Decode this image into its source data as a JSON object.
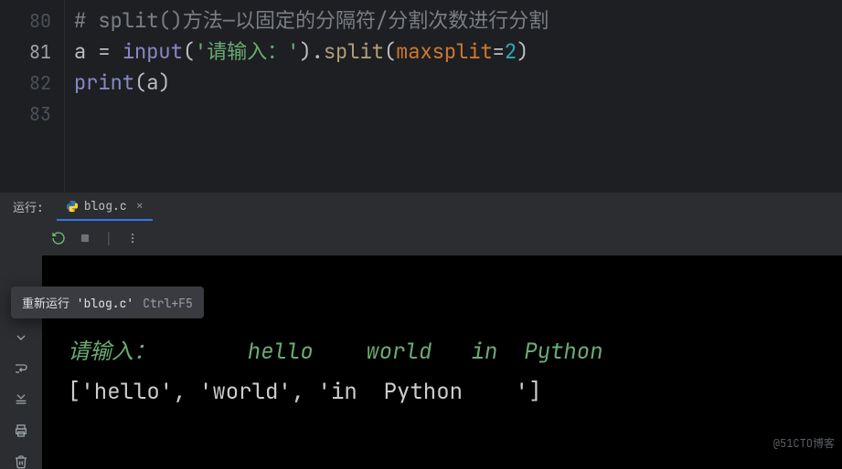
{
  "editor": {
    "lines": [
      {
        "num": "80",
        "active": false
      },
      {
        "num": "81",
        "active": true
      },
      {
        "num": "82",
        "active": false
      },
      {
        "num": "83",
        "active": false
      }
    ],
    "l80_comment": "# split()方法—以固定的分隔符/分割次数进行分割",
    "l81_a": "a ",
    "l81_eq": "= ",
    "l81_input": "input",
    "l81_paren1": "(",
    "l81_str": "'请输入：'",
    "l81_paren2": ")",
    "l81_dot": ".",
    "l81_split": "split",
    "l81_paren3": "(",
    "l81_param": "maxsplit",
    "l81_eq2": "=",
    "l81_num": "2",
    "l81_paren4": ")",
    "l82_print": "print",
    "l82_p1": "(",
    "l82_arg": "a",
    "l82_p2": ")"
  },
  "panel": {
    "title": "运行:",
    "tab_label": "blog.c",
    "tab_close": "×"
  },
  "tooltip": {
    "text": "重新运行 'blog.c'",
    "shortcut": "Ctrl+F5"
  },
  "console": {
    "prompt": "请输入：",
    "input_echo": "       hello    world   in  Python    ",
    "output": "['hello', 'world', 'in  Python    ']"
  },
  "watermark": "@51CTO博客"
}
